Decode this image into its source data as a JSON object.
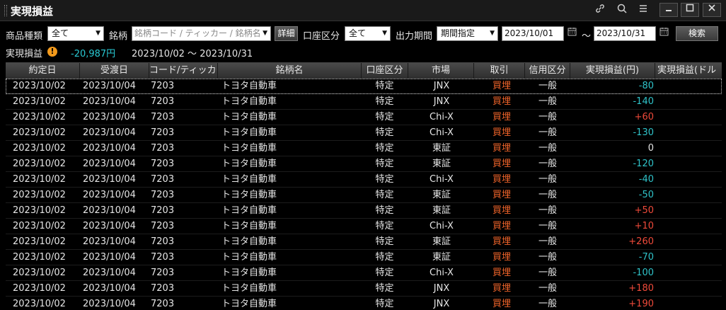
{
  "window": {
    "title": "実現損益",
    "icons": [
      "link-icon",
      "search-icon",
      "menu-icon"
    ],
    "controls": [
      "minimize",
      "maximize",
      "close"
    ]
  },
  "filters": {
    "product_type_label": "商品種類",
    "product_type_value": "全て",
    "symbol_label": "銘柄",
    "symbol_placeholder": "銘柄コード / ティッカー / 銘柄名",
    "detail_button": "詳細",
    "account_type_label": "口座区分",
    "account_type_value": "全て",
    "period_label": "出力期間",
    "period_value": "期間指定",
    "date_from": "2023/10/01",
    "tilde": "～",
    "date_to": "2023/10/31",
    "search_button": "検索"
  },
  "summary": {
    "label": "実現損益",
    "value": "-20,987円",
    "period": "2023/10/02 ～ 2023/10/31"
  },
  "table": {
    "columns": [
      "約定日",
      "受渡日",
      "コード/ティッカー",
      "銘柄名",
      "口座区分",
      "市場",
      "取引",
      "信用区分",
      "実現損益(円)",
      "実現損益(ドル"
    ],
    "rows": [
      {
        "trade_date": "2023/10/02",
        "settle_date": "2023/10/04",
        "code": "7203",
        "name": "トヨタ自動車",
        "account": "特定",
        "market": "JNX",
        "trade": "買埋",
        "credit": "一般",
        "pl": "-80"
      },
      {
        "trade_date": "2023/10/02",
        "settle_date": "2023/10/04",
        "code": "7203",
        "name": "トヨタ自動車",
        "account": "特定",
        "market": "JNX",
        "trade": "買埋",
        "credit": "一般",
        "pl": "-140"
      },
      {
        "trade_date": "2023/10/02",
        "settle_date": "2023/10/04",
        "code": "7203",
        "name": "トヨタ自動車",
        "account": "特定",
        "market": "Chi-X",
        "trade": "買埋",
        "credit": "一般",
        "pl": "+60"
      },
      {
        "trade_date": "2023/10/02",
        "settle_date": "2023/10/04",
        "code": "7203",
        "name": "トヨタ自動車",
        "account": "特定",
        "market": "Chi-X",
        "trade": "買埋",
        "credit": "一般",
        "pl": "-130"
      },
      {
        "trade_date": "2023/10/02",
        "settle_date": "2023/10/04",
        "code": "7203",
        "name": "トヨタ自動車",
        "account": "特定",
        "market": "東証",
        "trade": "買埋",
        "credit": "一般",
        "pl": "0"
      },
      {
        "trade_date": "2023/10/02",
        "settle_date": "2023/10/04",
        "code": "7203",
        "name": "トヨタ自動車",
        "account": "特定",
        "market": "東証",
        "trade": "買埋",
        "credit": "一般",
        "pl": "-120"
      },
      {
        "trade_date": "2023/10/02",
        "settle_date": "2023/10/04",
        "code": "7203",
        "name": "トヨタ自動車",
        "account": "特定",
        "market": "Chi-X",
        "trade": "買埋",
        "credit": "一般",
        "pl": "-40"
      },
      {
        "trade_date": "2023/10/02",
        "settle_date": "2023/10/04",
        "code": "7203",
        "name": "トヨタ自動車",
        "account": "特定",
        "market": "東証",
        "trade": "買埋",
        "credit": "一般",
        "pl": "-50"
      },
      {
        "trade_date": "2023/10/02",
        "settle_date": "2023/10/04",
        "code": "7203",
        "name": "トヨタ自動車",
        "account": "特定",
        "market": "東証",
        "trade": "買埋",
        "credit": "一般",
        "pl": "+50"
      },
      {
        "trade_date": "2023/10/02",
        "settle_date": "2023/10/04",
        "code": "7203",
        "name": "トヨタ自動車",
        "account": "特定",
        "market": "Chi-X",
        "trade": "買埋",
        "credit": "一般",
        "pl": "+10"
      },
      {
        "trade_date": "2023/10/02",
        "settle_date": "2023/10/04",
        "code": "7203",
        "name": "トヨタ自動車",
        "account": "特定",
        "market": "東証",
        "trade": "買埋",
        "credit": "一般",
        "pl": "+260"
      },
      {
        "trade_date": "2023/10/02",
        "settle_date": "2023/10/04",
        "code": "7203",
        "name": "トヨタ自動車",
        "account": "特定",
        "market": "東証",
        "trade": "買埋",
        "credit": "一般",
        "pl": "-70"
      },
      {
        "trade_date": "2023/10/02",
        "settle_date": "2023/10/04",
        "code": "7203",
        "name": "トヨタ自動車",
        "account": "特定",
        "market": "Chi-X",
        "trade": "買埋",
        "credit": "一般",
        "pl": "-100"
      },
      {
        "trade_date": "2023/10/02",
        "settle_date": "2023/10/04",
        "code": "7203",
        "name": "トヨタ自動車",
        "account": "特定",
        "market": "JNX",
        "trade": "買埋",
        "credit": "一般",
        "pl": "+180"
      },
      {
        "trade_date": "2023/10/02",
        "settle_date": "2023/10/04",
        "code": "7203",
        "name": "トヨタ自動車",
        "account": "特定",
        "market": "JNX",
        "trade": "買埋",
        "credit": "一般",
        "pl": "+190"
      }
    ]
  },
  "colors": {
    "negative": "#2fc3c9",
    "positive": "#ef4a3a",
    "trade_text": "#f0642a",
    "warning": "#f39a1c"
  }
}
